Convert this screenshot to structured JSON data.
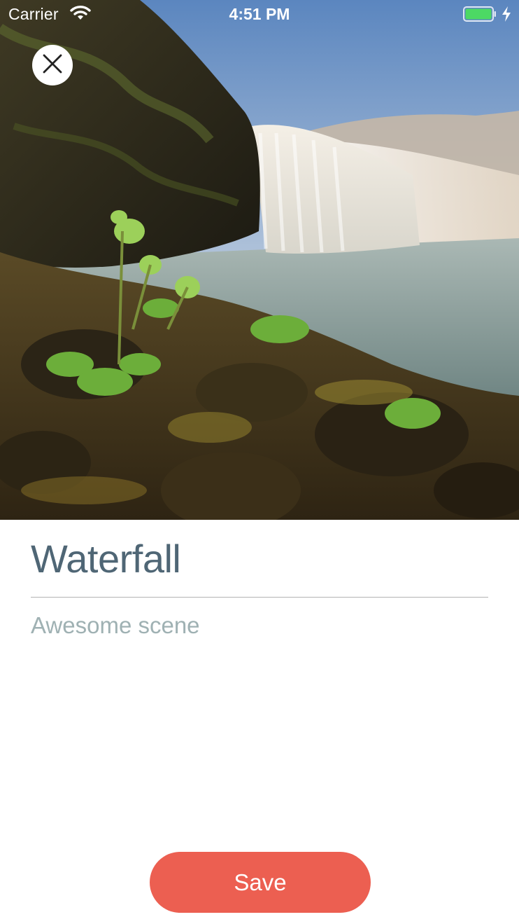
{
  "status_bar": {
    "carrier": "Carrier",
    "time": "4:51 PM",
    "wifi_icon": "wifi-icon",
    "battery_icon": "battery-icon",
    "charging_icon": "charging-bolt-icon",
    "battery_level": 1.0,
    "battery_color": "#4cd964"
  },
  "photo": {
    "subject": "waterfall landscape"
  },
  "close_button": {
    "icon": "close-icon"
  },
  "form": {
    "title_value": "Waterfall",
    "description_value": "Awesome scene",
    "title_color": "#4f6675",
    "description_color": "#9fb1b3"
  },
  "actions": {
    "save_label": "Save",
    "save_color": "#ec5f51"
  }
}
